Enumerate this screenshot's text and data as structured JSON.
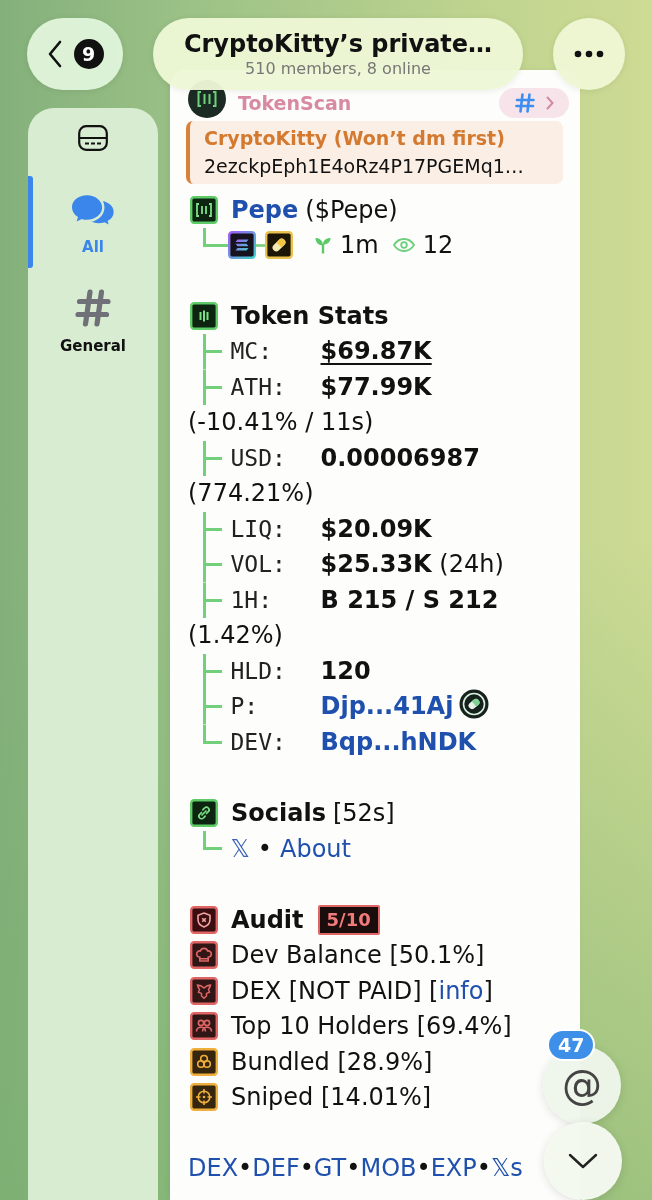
{
  "header": {
    "back_badge": "9",
    "title": "CryptoKitty’s private…",
    "subtitle": "510 members, 8 online"
  },
  "sidebar": {
    "items": [
      {
        "label": "All",
        "selected": true
      },
      {
        "label": "General",
        "selected": false
      }
    ]
  },
  "message": {
    "sender": "TokenScan",
    "reply": {
      "name": "CryptoKitty (Won’t dm first)",
      "text": "2ezckpEph1E4oRz4P17PGEMq1…"
    },
    "token": {
      "name": "Pepe",
      "symbol": "($Pepe)",
      "age": "1m",
      "views": "12"
    },
    "token_stats": {
      "title": "Token Stats",
      "rows": [
        {
          "label": "MC:",
          "value": "$69.87K",
          "kind": "underlined"
        },
        {
          "label": "ATH:",
          "value": "$77.99K",
          "note": "(-10.41% / 11s)",
          "kind": "plain"
        },
        {
          "label": "USD:",
          "value": "0.00006987",
          "note": "(774.21%)",
          "kind": "plain"
        },
        {
          "label": "LIQ:",
          "value": "$20.09K",
          "kind": "plain"
        },
        {
          "label": "VOL:",
          "value": "$25.33K",
          "note": "(24h)",
          "kind": "plain"
        },
        {
          "label": "1H:",
          "value": "B 215 / S 212",
          "note": "(1.42%)",
          "kind": "plain"
        },
        {
          "label": "HLD:",
          "value": "120",
          "kind": "plain"
        },
        {
          "label": "P:",
          "value": "Djp...41Aj",
          "kind": "link_icon"
        },
        {
          "label": "DEV:",
          "value": "Bqp...hNDK",
          "kind": "link"
        }
      ]
    },
    "socials": {
      "title": "Socials",
      "age": "[52s]",
      "links": [
        "𝕏",
        "About"
      ],
      "separator": "•"
    },
    "audit": {
      "title": "Audit",
      "score": "5/10",
      "items": [
        {
          "parts": [
            {
              "kind": "text",
              "text": "Dev Balance [50.1%]"
            }
          ],
          "color": "#e06666"
        },
        {
          "parts": [
            {
              "kind": "text",
              "text": "DEX [NOT PAID] ["
            },
            {
              "kind": "link",
              "text": "info"
            },
            {
              "kind": "text",
              "text": "]"
            }
          ],
          "color": "#e06666"
        },
        {
          "parts": [
            {
              "kind": "text",
              "text": "Top 10 Holders [69.4%]"
            }
          ],
          "color": "#e06666"
        },
        {
          "parts": [
            {
              "kind": "text",
              "text": "Bundled [28.9%]"
            }
          ],
          "color": "#f0ae3c"
        },
        {
          "parts": [
            {
              "kind": "text",
              "text": "Sniped [14.01%]"
            }
          ],
          "color": "#f0ae3c"
        }
      ]
    },
    "footer": {
      "links": [
        "DEX",
        "DEF",
        "GT",
        "MOB",
        "EXP",
        "𝕏s"
      ],
      "separator": "•"
    }
  },
  "mention": {
    "symbol": "@",
    "count": "47"
  }
}
